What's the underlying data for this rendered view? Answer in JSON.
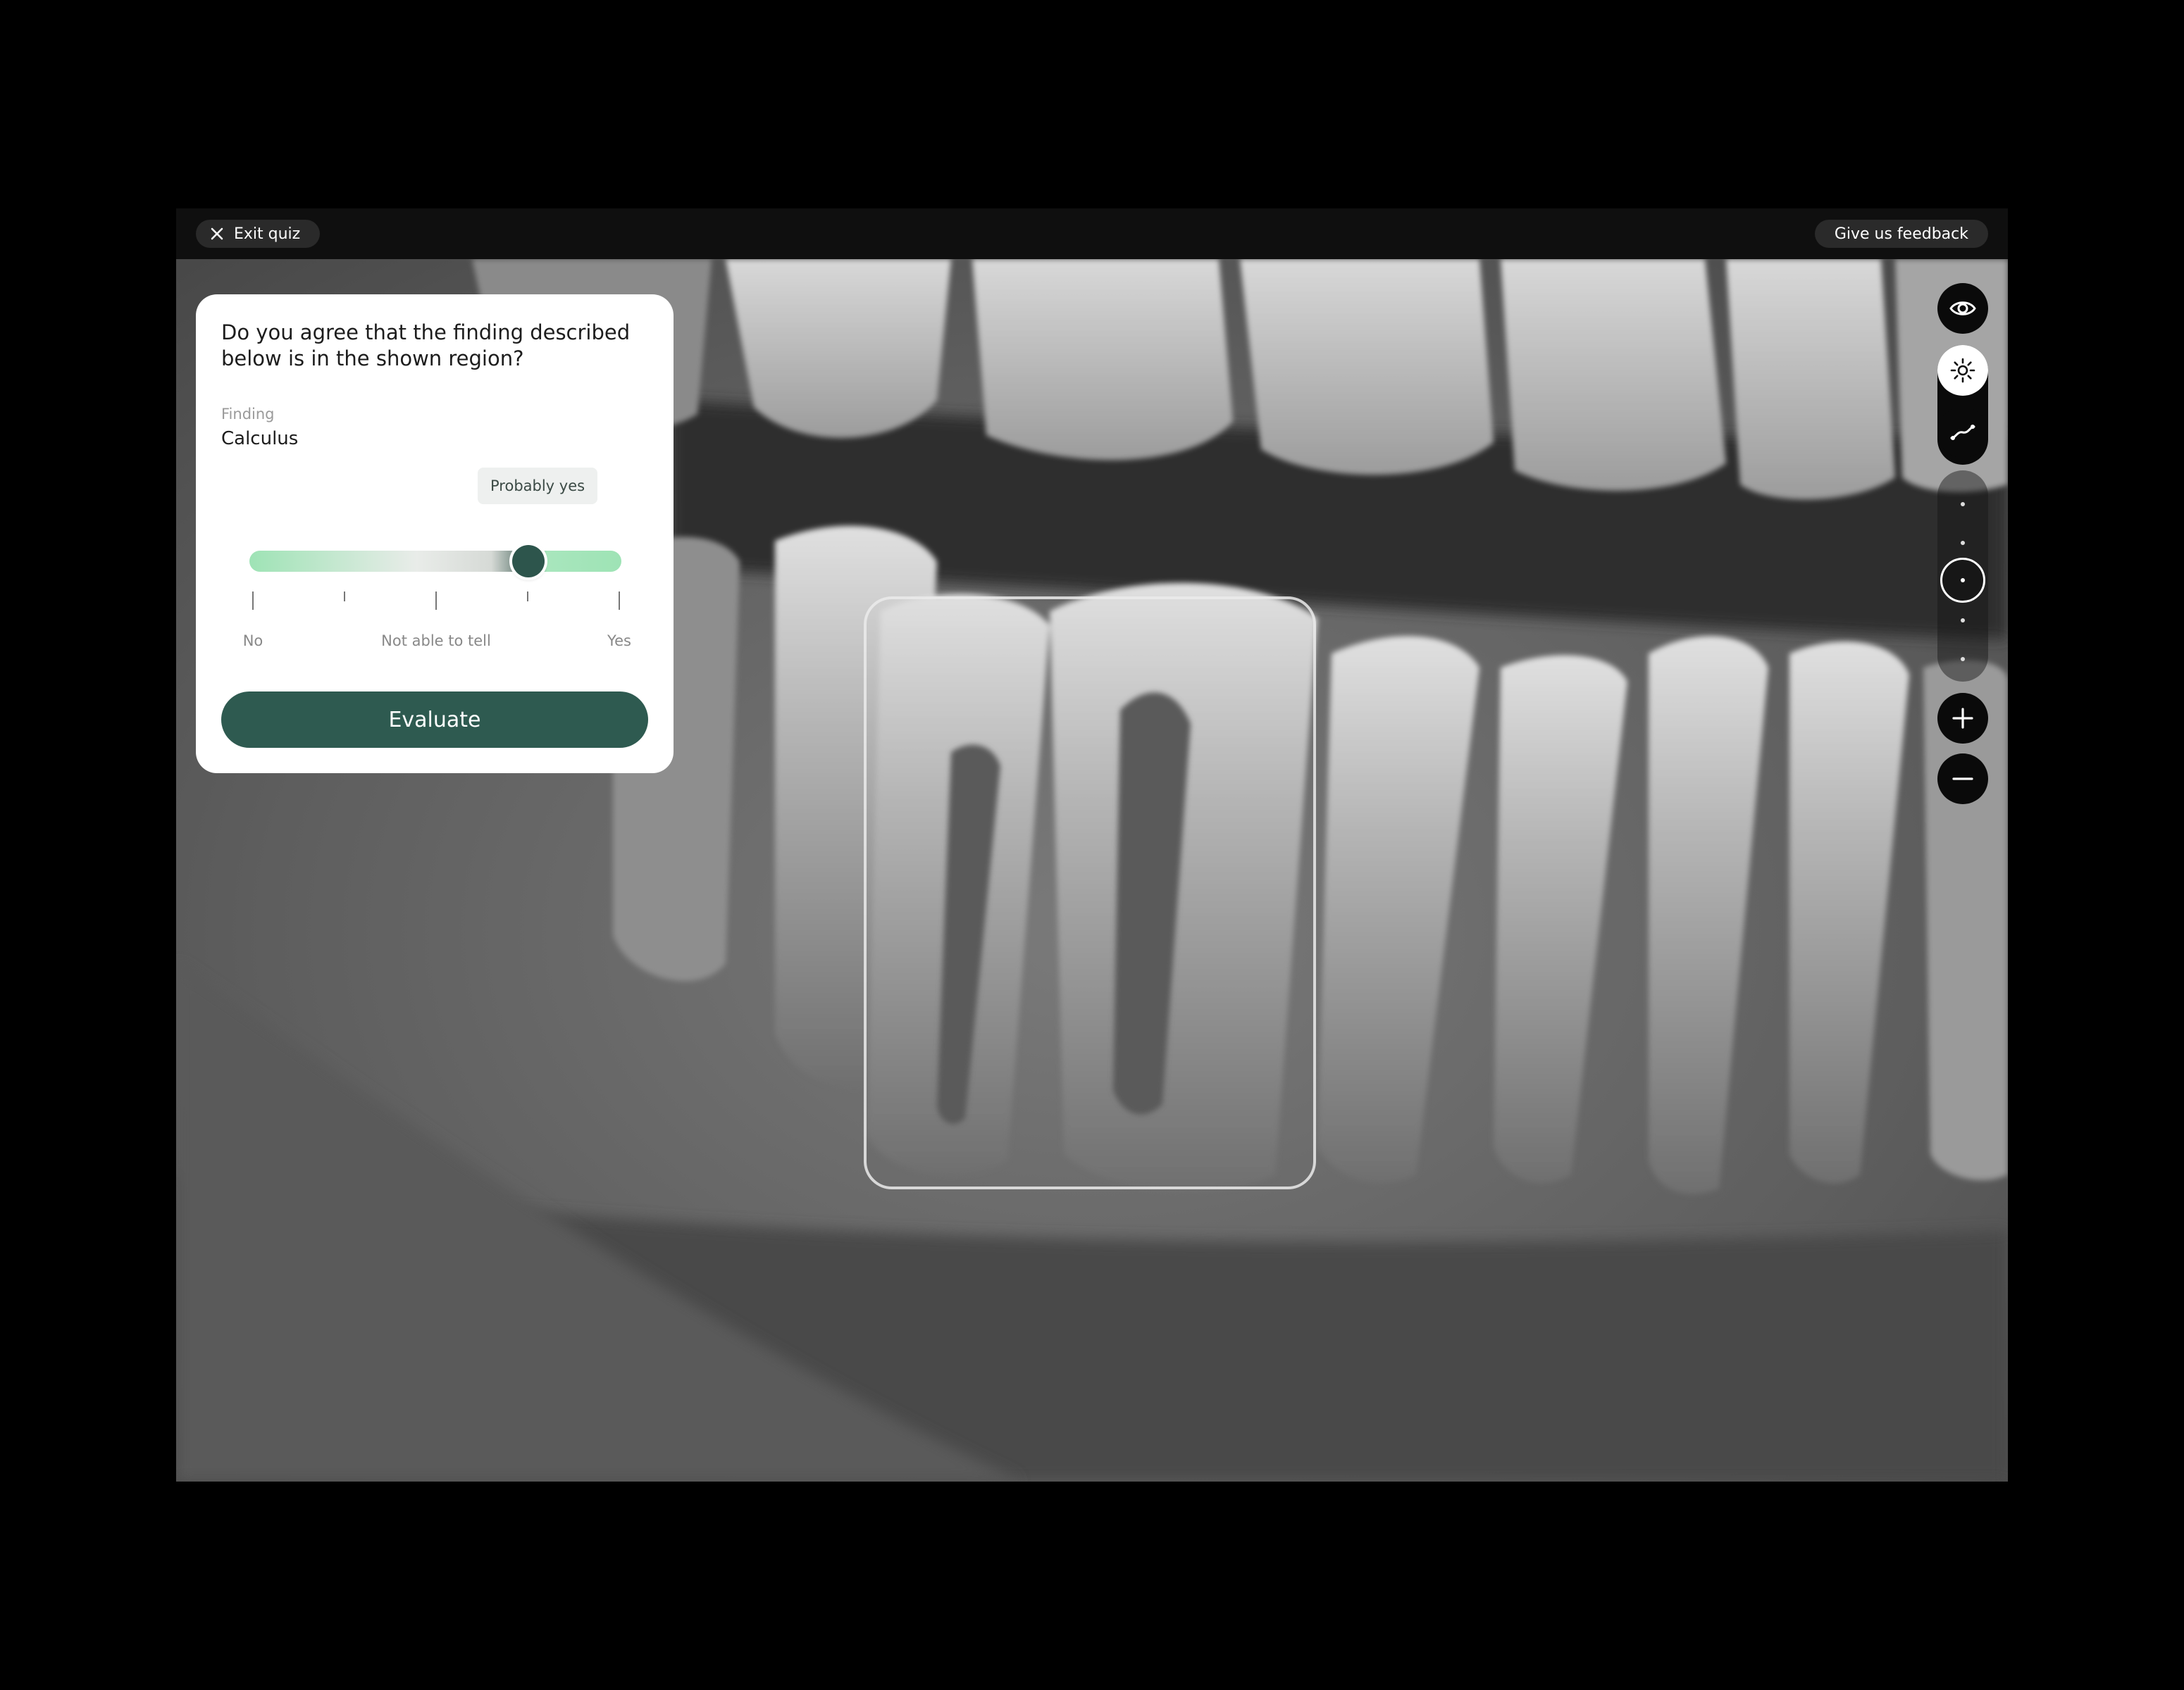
{
  "topbar": {
    "exit_label": "Exit quiz",
    "feedback_label": "Give us feedback"
  },
  "quiz": {
    "question": "Do you agree that the finding described below is in the shown region?",
    "finding_label": "Finding",
    "finding_value": "Calculus",
    "answer_tooltip": "Probably yes",
    "slider_value": 0.75,
    "scale_labels": {
      "no": "No",
      "middle": "Not able to tell",
      "yes": "Yes"
    },
    "evaluate_label": "Evaluate"
  },
  "toolbar": {
    "icons": [
      "eye-icon",
      "brightness-icon",
      "curve-icon",
      "plus-icon",
      "minus-icon"
    ],
    "zoom_steps": 5,
    "zoom_selected_step": 3
  },
  "colors": {
    "accent": "#2e5a50",
    "slider_green": "#9ee3b5"
  }
}
